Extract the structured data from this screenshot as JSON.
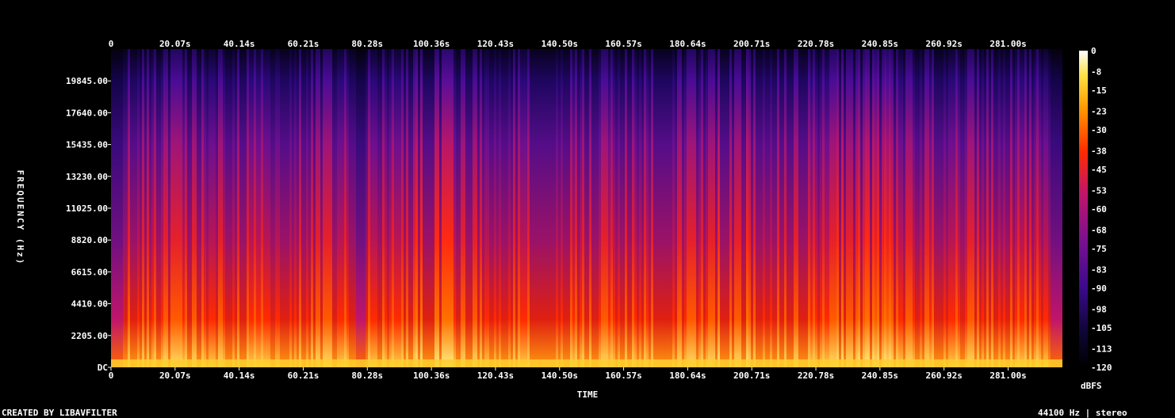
{
  "chart_data": {
    "type": "heatmap",
    "title": "",
    "xlabel": "TIME",
    "ylabel": "FREQUENCY (Hz)",
    "x_ticks": [
      "0",
      "20.07s",
      "40.14s",
      "60.21s",
      "80.28s",
      "100.36s",
      "120.43s",
      "140.50s",
      "160.57s",
      "180.64s",
      "200.71s",
      "220.78s",
      "240.85s",
      "260.92s",
      "281.00s"
    ],
    "x_tick_values": [
      0,
      20.07,
      40.14,
      60.21,
      80.28,
      100.36,
      120.43,
      140.5,
      160.57,
      180.64,
      200.71,
      220.78,
      240.85,
      260.92,
      281.0
    ],
    "xlim": [
      0,
      298
    ],
    "y_ticks": [
      "DC",
      "2205.00",
      "4410.00",
      "6615.00",
      "8820.00",
      "11025.00",
      "13230.00",
      "15435.00",
      "17640.00",
      "19845.00"
    ],
    "y_tick_values": [
      0,
      2205,
      4410,
      6615,
      8820,
      11025,
      13230,
      15435,
      17640,
      19845
    ],
    "ylim": [
      0,
      22050
    ],
    "colorbar": {
      "label": "dBFS",
      "ticks": [
        "0",
        "-8",
        "-15",
        "-23",
        "-30",
        "-38",
        "-45",
        "-53",
        "-60",
        "-68",
        "-75",
        "-83",
        "-90",
        "-98",
        "-105",
        "-113",
        "-120"
      ],
      "tick_values": [
        0,
        -8,
        -15,
        -23,
        -30,
        -38,
        -45,
        -53,
        -60,
        -68,
        -75,
        -83,
        -90,
        -98,
        -105,
        -113,
        -120
      ],
      "range": [
        -120,
        0
      ]
    },
    "colors": {
      "low": "#000000",
      "mid_low": "#3a0a8c",
      "mid": "#c0156a",
      "mid_high": "#ff2a00",
      "high": "#ffe040",
      "peak": "#ffffff"
    }
  },
  "footer": {
    "credit": "CREATED BY LIBAVFILTER",
    "format": "44100 Hz | stereo"
  }
}
